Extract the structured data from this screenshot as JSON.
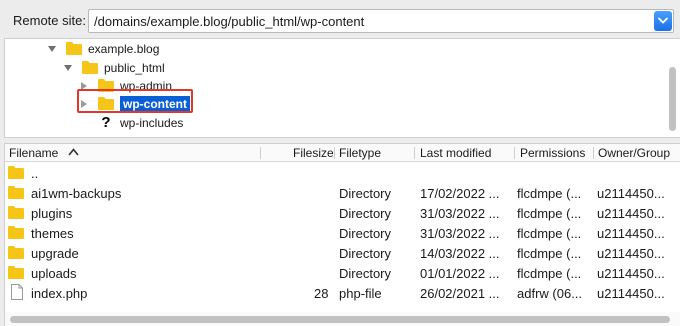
{
  "remote_site": {
    "label": "Remote site:",
    "path": "/domains/example.blog/public_html/wp-content"
  },
  "tree": {
    "items": [
      {
        "label": "example.blog",
        "icon": "folder-icon",
        "expanded": true
      },
      {
        "label": "public_html",
        "icon": "folder-icon",
        "expanded": true
      },
      {
        "label": "wp-admin",
        "icon": "folder-icon",
        "expanded": false
      },
      {
        "label": "wp-content",
        "icon": "folder-icon",
        "expanded": false,
        "selected": true
      },
      {
        "label": "wp-includes",
        "icon": "question-mark-icon",
        "question_mark": "?"
      }
    ]
  },
  "listing": {
    "columns": [
      "Filename",
      "Filesize",
      "Filetype",
      "Last modified",
      "Permissions",
      "Owner/Group"
    ],
    "sort_column": "Filename",
    "rows": [
      {
        "name": "..",
        "size": "",
        "type": "",
        "modified": "",
        "perms": "",
        "owner": "",
        "icon": "folder-icon"
      },
      {
        "name": "ai1wm-backups",
        "size": "",
        "type": "Directory",
        "modified": "17/02/2022 ...",
        "perms": "flcdmpe (...",
        "owner": "u2114450...",
        "icon": "folder-icon"
      },
      {
        "name": "plugins",
        "size": "",
        "type": "Directory",
        "modified": "31/03/2022 ...",
        "perms": "flcdmpe (...",
        "owner": "u2114450...",
        "icon": "folder-icon"
      },
      {
        "name": "themes",
        "size": "",
        "type": "Directory",
        "modified": "31/03/2022 ...",
        "perms": "flcdmpe (...",
        "owner": "u2114450...",
        "icon": "folder-icon"
      },
      {
        "name": "upgrade",
        "size": "",
        "type": "Directory",
        "modified": "14/03/2022 ...",
        "perms": "flcdmpe (...",
        "owner": "u2114450...",
        "icon": "folder-icon"
      },
      {
        "name": "uploads",
        "size": "",
        "type": "Directory",
        "modified": "01/01/2022 ...",
        "perms": "flcdmpe (...",
        "owner": "u2114450...",
        "icon": "folder-icon"
      },
      {
        "name": "index.php",
        "size": "28",
        "type": "php-file",
        "modified": "26/02/2021 ...",
        "perms": "adfrw (06...",
        "owner": "u2114450...",
        "icon": "file-icon"
      }
    ]
  },
  "colors": {
    "folder": "#f5c518",
    "selection": "#0a5fd6",
    "highlight_box": "#e0392b"
  }
}
